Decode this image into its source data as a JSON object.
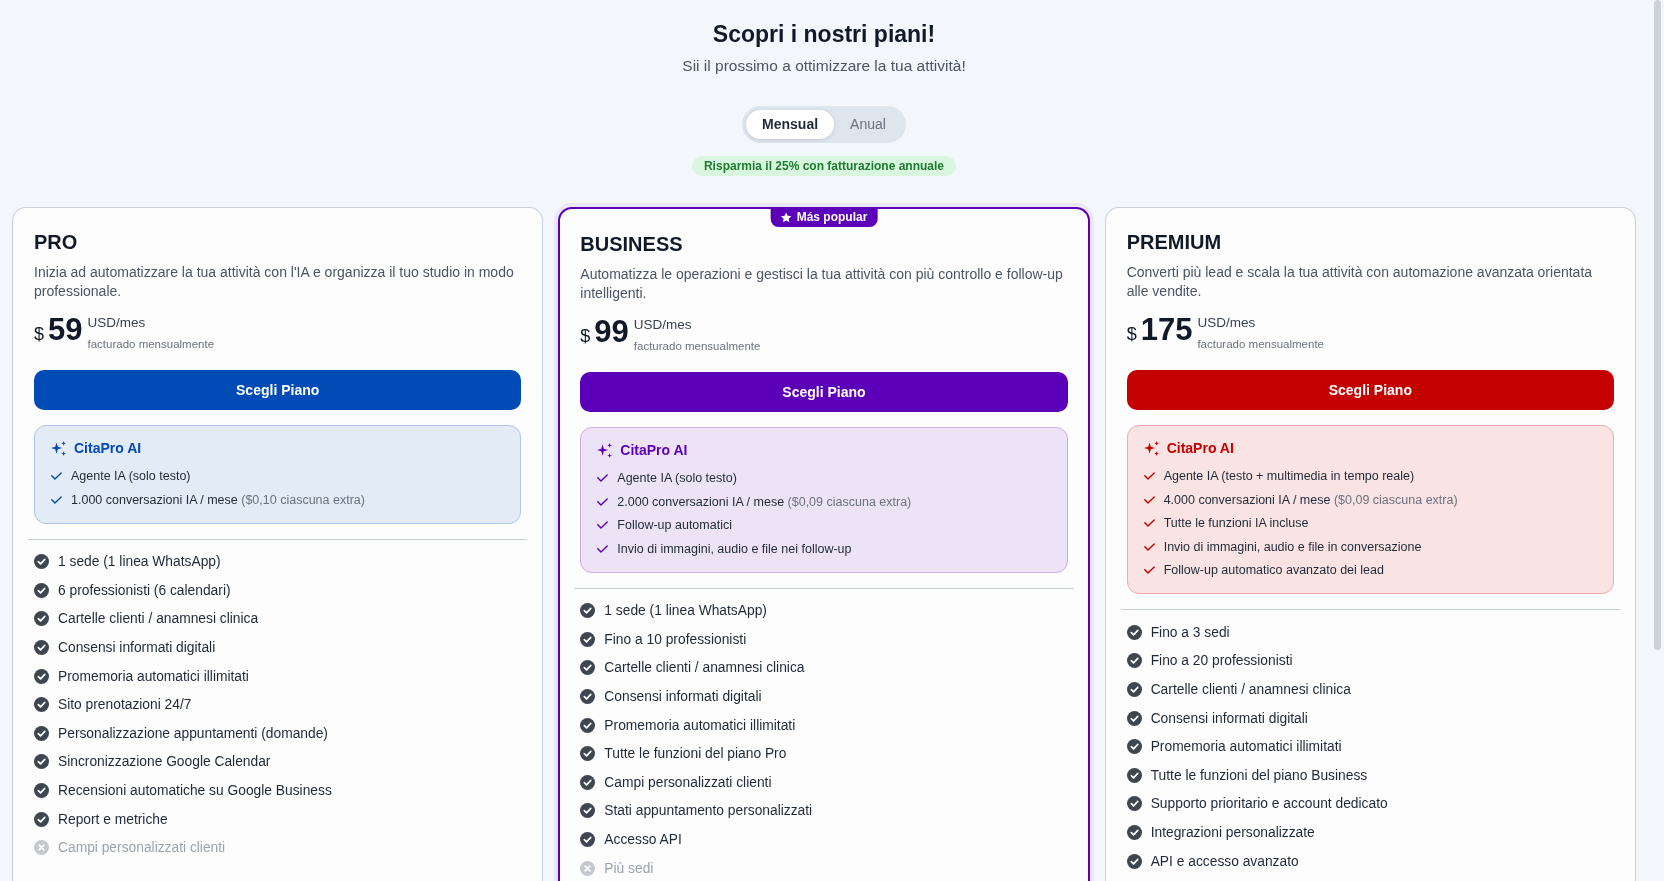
{
  "header": {
    "title": "Scopri i nostri piani!",
    "subtitle": "Sii il prossimo a ottimizzare la tua attività!"
  },
  "billing_toggle": [
    {
      "label": "Mensual",
      "selected": true
    },
    {
      "label": "Anual",
      "selected": false
    }
  ],
  "savings_badge": "Risparmia il 25% con fatturazione annuale",
  "plans": [
    {
      "name": "PRO",
      "highlighted": false,
      "color": "#004bb5",
      "description": "Inizia ad automatizzare la tua attività con l'IA e organizza il tuo studio in modo professionale.",
      "price": {
        "currency": "$",
        "amount": "59",
        "unit": "USD/mes",
        "billing_note": "facturado mensualmente"
      },
      "button": "Scegli Piano",
      "ai": {
        "title": "CitaPro AI",
        "items": [
          {
            "text": "Agente IA (solo testo)"
          },
          {
            "text": "1.000 conversazioni IA / mese",
            "note": "($0,10 ciascuna extra)"
          }
        ]
      },
      "features": [
        {
          "text": "1 sede (1 linea WhatsApp)",
          "included": true
        },
        {
          "text": "6 professionisti (6 calendari)",
          "included": true
        },
        {
          "text": "Cartelle clienti / anamnesi clinica",
          "included": true
        },
        {
          "text": "Consensi informati digitali",
          "included": true
        },
        {
          "text": "Promemoria automatici illimitati",
          "included": true
        },
        {
          "text": "Sito prenotazioni 24/7",
          "included": true
        },
        {
          "text": "Personalizzazione appuntamenti (domande)",
          "included": true
        },
        {
          "text": "Sincronizzazione Google Calendar",
          "included": true
        },
        {
          "text": "Recensioni automatiche su Google Business",
          "included": true
        },
        {
          "text": "Report e metriche",
          "included": true
        },
        {
          "text": "Campi personalizzati clienti",
          "included": false
        }
      ]
    },
    {
      "name": "BUSINESS",
      "highlighted": true,
      "badge": "Más popular",
      "color": "#5b00b8",
      "description": "Automatizza le operazioni e gestisci la tua attività con più controllo e follow-up intelligenti.",
      "price": {
        "currency": "$",
        "amount": "99",
        "unit": "USD/mes",
        "billing_note": "facturado mensualmente"
      },
      "button": "Scegli Piano",
      "ai": {
        "title": "CitaPro AI",
        "items": [
          {
            "text": "Agente IA (solo testo)"
          },
          {
            "text": "2.000 conversazioni IA / mese",
            "note": "($0,09 ciascuna extra)"
          },
          {
            "text": "Follow-up automatici"
          },
          {
            "text": "Invio di immagini, audio e file nei follow-up"
          }
        ]
      },
      "features": [
        {
          "text": "1 sede (1 linea WhatsApp)",
          "included": true
        },
        {
          "text": "Fino a 10 professionisti",
          "included": true
        },
        {
          "text": "Cartelle clienti / anamnesi clinica",
          "included": true
        },
        {
          "text": "Consensi informati digitali",
          "included": true
        },
        {
          "text": "Promemoria automatici illimitati",
          "included": true
        },
        {
          "text": "Tutte le funzioni del piano Pro",
          "included": true
        },
        {
          "text": "Campi personalizzati clienti",
          "included": true
        },
        {
          "text": "Stati appuntamento personalizzati",
          "included": true
        },
        {
          "text": "Accesso API",
          "included": true
        },
        {
          "text": "Più sedi",
          "included": false
        }
      ]
    },
    {
      "name": "PREMIUM",
      "highlighted": false,
      "color": "#c40000",
      "description": "Converti più lead e scala la tua attività con automazione avanzata orientata alle vendite.",
      "price": {
        "currency": "$",
        "amount": "175",
        "unit": "USD/mes",
        "billing_note": "facturado mensualmente"
      },
      "button": "Scegli Piano",
      "ai": {
        "title": "CitaPro AI",
        "items": [
          {
            "text": "Agente IA (testo + multimedia in tempo reale)"
          },
          {
            "text": "4.000 conversazioni IA / mese",
            "note": "($0,09 ciascuna extra)"
          },
          {
            "text": "Tutte le funzioni IA incluse"
          },
          {
            "text": "Invio di immagini, audio e file in conversazione"
          },
          {
            "text": "Follow-up automatico avanzato dei lead"
          }
        ]
      },
      "features": [
        {
          "text": "Fino a 3 sedi",
          "included": true
        },
        {
          "text": "Fino a 20 professionisti",
          "included": true
        },
        {
          "text": "Cartelle clienti / anamnesi clinica",
          "included": true
        },
        {
          "text": "Consensi informati digitali",
          "included": true
        },
        {
          "text": "Promemoria automatici illimitati",
          "included": true
        },
        {
          "text": "Tutte le funzioni del piano Business",
          "included": true
        },
        {
          "text": "Supporto prioritario e account dedicato",
          "included": true
        },
        {
          "text": "Integrazioni personalizzate",
          "included": true
        },
        {
          "text": "API e accesso avanzato",
          "included": true
        }
      ]
    }
  ]
}
